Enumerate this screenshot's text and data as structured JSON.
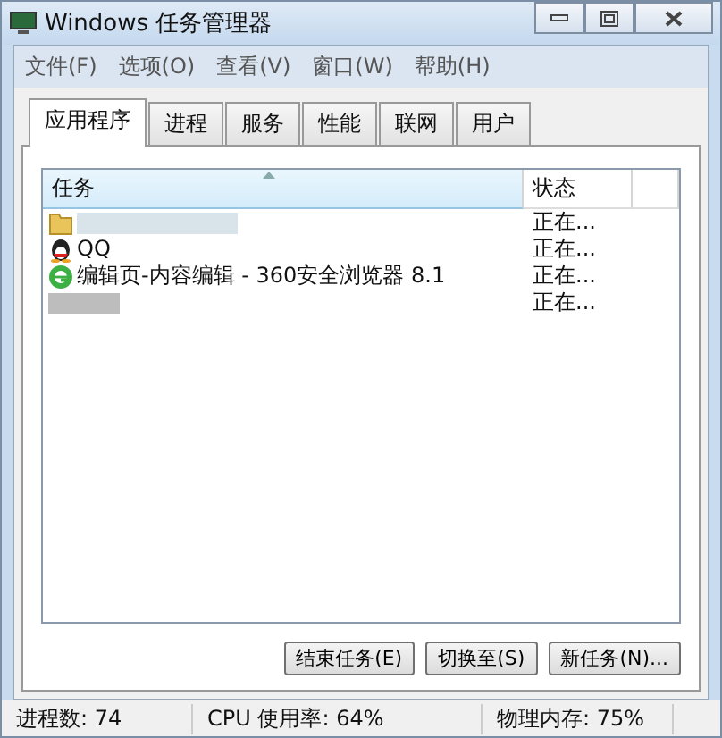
{
  "window": {
    "title": "Windows 任务管理器"
  },
  "menu": [
    "文件(F)",
    "选项(O)",
    "查看(V)",
    "窗口(W)",
    "帮助(H)"
  ],
  "tabs": [
    {
      "label": "应用程序",
      "selected": true
    },
    {
      "label": "进程",
      "selected": false
    },
    {
      "label": "服务",
      "selected": false
    },
    {
      "label": "性能",
      "selected": false
    },
    {
      "label": "联网",
      "selected": false
    },
    {
      "label": "用户",
      "selected": false
    }
  ],
  "table": {
    "columns": [
      "任务",
      "状态"
    ],
    "rows": [
      {
        "kind": "folder",
        "task": "",
        "status": "正在..."
      },
      {
        "kind": "penguin",
        "task": "QQ",
        "status": "正在..."
      },
      {
        "kind": "browser",
        "task": "编辑页-内容编辑 - 360安全浏览器 8.1",
        "status": "正在..."
      },
      {
        "kind": "hidden",
        "task": "",
        "status": "正在..."
      }
    ]
  },
  "buttons": [
    "结束任务(E)",
    "切换至(S)",
    "新任务(N)..."
  ],
  "status_bar": [
    "进程数: 74",
    "CPU 使用率: 64%",
    "物理内存: 75%"
  ]
}
